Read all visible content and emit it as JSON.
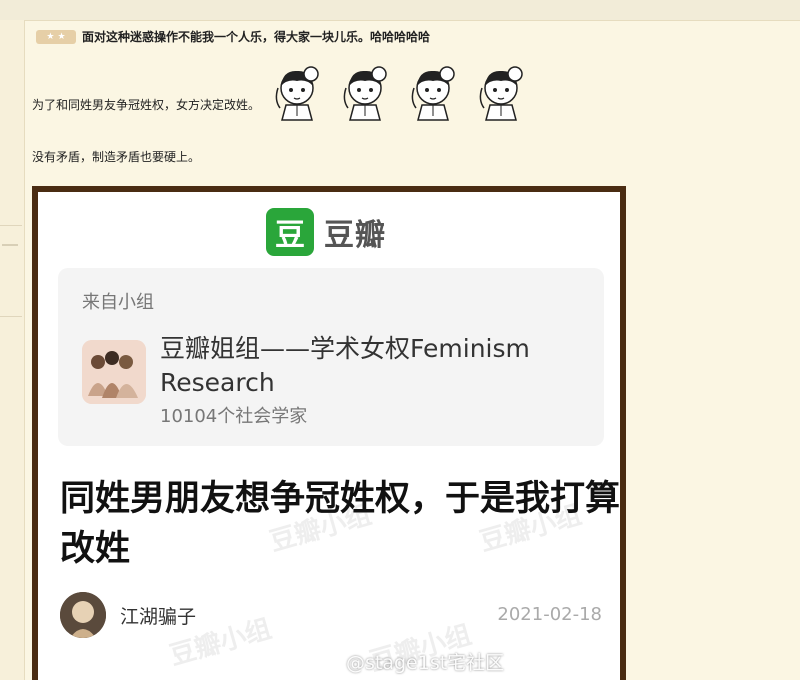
{
  "forum": {
    "badge_stars": [
      "★",
      "★"
    ],
    "header_text": "面对这种迷惑操作不能我一个人乐，得大家一块儿乐。哈哈哈哈哈",
    "line1": "为了和同姓男友争冠姓权，女方决定改姓。",
    "line2": "没有矛盾，制造矛盾也要硬上。"
  },
  "screenshot": {
    "logo_glyph": "豆",
    "logo_text": "豆瓣",
    "group_card": {
      "from_label": "来自小组",
      "group_name": "豆瓣姐组——学术女权Feminism Research",
      "members": "10104个社会学家"
    },
    "post_title": "同姓男朋友想争冠姓权，于是我打算改姓",
    "author_name": "江湖骗子",
    "date": "2021-02-18",
    "watermarks": [
      "豆瓣小组",
      "豆瓣小组",
      "豆瓣小组",
      "豆瓣小组"
    ],
    "weibo_watermark": "@stage1st宅社区"
  },
  "icon_names": {
    "girl_sticker": "anime-girl-sticker-icon",
    "logo": "douban-logo-icon",
    "weibo": "weibo-logo-icon"
  },
  "colors": {
    "background": "#fbf6e3",
    "douban_green": "#2aa63a",
    "frame_brown": "#4a2c12"
  }
}
